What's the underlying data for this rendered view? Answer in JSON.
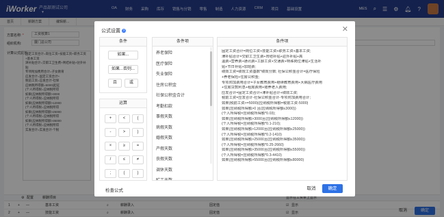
{
  "app": {
    "logo": "iWorker",
    "company": "产品部测试公司"
  },
  "nav": [
    "OA",
    "财务",
    "采购",
    "库存",
    "销售与分销",
    "零售",
    "制造",
    "人力资源",
    "CRM",
    "项目",
    "基础设置"
  ],
  "topbar": {
    "mes": "MES"
  },
  "tabs": [
    "首页",
    "薪酬方案",
    "编辑薪..."
  ],
  "background": {
    "scheme_label": "方案名称:",
    "scheme_value": "工资核算1",
    "org_label": "组织机构:",
    "org_value": "厦门总公司",
    "formula_label": "计算公式提示:",
    "formula_preview": "固定工资合计=岗位工资+技能工资+职务工资+基本工资\n津补贴合计=交职工卫生费+胃结补贴+驻外补贴\n专项附加费用合计=子女教育\n应发合计=固定工资合计+\n税前工资=应发合计-社保\n应纳税所得额=5000(起征\n(个人所得税=应纳税所得\n如果(应纳税所得额>3000\n(个人所得税=应纳税所得\n如果(应纳税所得额>12000\n(个人所得税=应纳税所得\n如果(应纳税所得额>25000\n(个人所得税=应纳税所得\n如果(应纳税所得额>35000\n(个人所得税=应纳税所得\n实发合计=实发合计-个税",
    "grid_head": {
      "config": "配置",
      "salary_item": "薪酬项目",
      "show": "显示在工资条上显示"
    },
    "rows": [
      {
        "no": "1",
        "item": "基本工资",
        "source": "薪酬录入",
        "detail": "固定值",
        "show": "显示"
      },
      {
        "no": "2",
        "item": "技能工资",
        "source": "薪酬录入",
        "detail": "固定值",
        "show": "显示"
      }
    ],
    "cancel": "取消",
    "ok": "确定"
  },
  "dialog": {
    "title": "公式设置",
    "conditions_head": "条件",
    "cond_buttons": [
      "如果...",
      "如果...否则...",
      "且",
      "或"
    ],
    "operators_head": "运算",
    "operators": [
      "+",
      "<",
      "(",
      "-",
      ">",
      ")",
      "×",
      "≥",
      "=",
      "/",
      "≤",
      "≠",
      ";",
      "(",
      ")"
    ],
    "items_head": "条件项",
    "items": [
      "养老保险",
      "医疗保险",
      "失业保险",
      "住房公积金",
      "社保公积金合计",
      "考勤扣款",
      "事假天数",
      "病假天数",
      "婚假天数",
      "产假天数",
      "丧假天数",
      "调休天数",
      "旷工天数"
    ],
    "expr_head": "条件项",
    "expression": [
      "固定工资合计=岗位工资+技能工资+职务工资+基本工资;",
      "津补贴合计=交职工卫生费+胃结补贴+驻外补贴+高",
      "温费+营养费+通讯费+工龄工资+交通费+特殊岗位津贴+生活补",
      "贴+节日补贴+加班费;",
      "绩效工资=绩效工资基数*绩效分数; 社保公积金合计=医疗保险",
      "+养老保险+住房公积金;",
      "专项附加费用合计=子女教育费用+继续教育费用+大病医疗费用",
      "+住房贷款利息+租房费用+赡养老人费用;",
      "应发合计=固定工资合计+津补贴合计+绩效工资;",
      "税前工资=应发合计-社保公积金合计-专项附加费用合计;",
      "如果(税前工资>=5000)(应纳税所得额=税前工资-5000)",
      "如果(应纳税所得额>0 且(应纳税所得额≤3000))",
      "(个人所得税=应纳税所得额*0.03);",
      "如果(应纳税所得额>3000且(应纳税所得额≤12000))",
      "(个人所得税=应纳税所得额*0.1-210);",
      "如果(应纳税所得额>12000且(应纳税所得额≤25000))",
      "(个人所得税=应纳税所得额*0.2-1410)",
      "如果(应纳税所得额>25000且(应纳税所得额≤35000))",
      "(个人所得税=应纳税所得额*0.25-2660)",
      "如果(应纳税所得额>35000且(应纳税所得额≤55000))",
      "(个人所得税=应纳税所得额*0.3-4410)",
      "如果(应纳税所得额>55000且(应纳税所得额≤80000)"
    ],
    "check": "检查公式",
    "cancel": "取消",
    "ok": "确定"
  }
}
